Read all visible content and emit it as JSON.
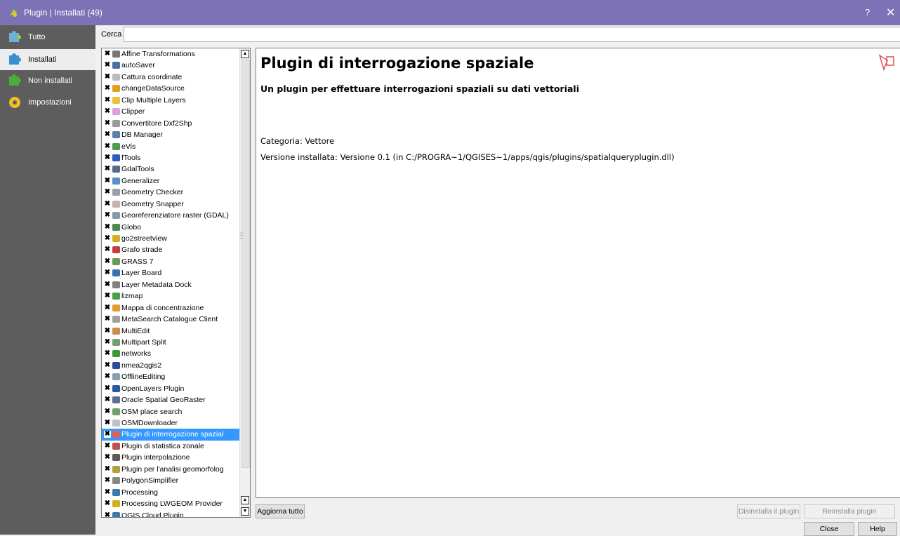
{
  "window": {
    "title": "Plugin | Installati (49)",
    "help_label": "?",
    "close_label": "✕"
  },
  "nav": {
    "items": [
      {
        "label": "Tutto",
        "icon": "puzzle-all-icon",
        "selected": false
      },
      {
        "label": "Installati",
        "icon": "puzzle-installed-icon",
        "selected": true
      },
      {
        "label": "Non installati",
        "icon": "puzzle-not-installed-icon",
        "selected": false
      },
      {
        "label": "Impostazioni",
        "icon": "gear-icon",
        "selected": false
      }
    ]
  },
  "search": {
    "label": "Cerca",
    "value": "",
    "placeholder": ""
  },
  "plugins": [
    {
      "name": "Affine Transformations",
      "color": "#777777"
    },
    {
      "name": "autoSaver",
      "color": "#4a6fa5"
    },
    {
      "name": "Cattura coordinate",
      "color": "#bbbbbb"
    },
    {
      "name": "changeDataSource",
      "color": "#e0a020"
    },
    {
      "name": "Clip Multiple Layers",
      "color": "#e8c43a"
    },
    {
      "name": "Clipper",
      "color": "#d9a0d9"
    },
    {
      "name": "Convertitore Dxf2Shp",
      "color": "#999999"
    },
    {
      "name": "DB Manager",
      "color": "#5a7fa8"
    },
    {
      "name": "eVis",
      "color": "#4f9a4f"
    },
    {
      "name": "fTools",
      "color": "#2a5fc0"
    },
    {
      "name": "GdalTools",
      "color": "#556b8a"
    },
    {
      "name": "Generalizer",
      "color": "#5a8fc0"
    },
    {
      "name": "Geometry Checker",
      "color": "#9aa0a8"
    },
    {
      "name": "Geometry Snapper",
      "color": "#c8b0b0"
    },
    {
      "name": "Georeferenziatore raster (GDAL)",
      "color": "#8899aa"
    },
    {
      "name": "Globo",
      "color": "#4a8a4a"
    },
    {
      "name": "go2streetview",
      "color": "#d4b020"
    },
    {
      "name": "Grafo strade",
      "color": "#c04040"
    },
    {
      "name": "GRASS 7",
      "color": "#6a9a5a"
    },
    {
      "name": "Layer Board",
      "color": "#3a6fb0"
    },
    {
      "name": "Layer Metadata Dock",
      "color": "#808080"
    },
    {
      "name": "lizmap",
      "color": "#48a048"
    },
    {
      "name": "Mappa di concentrazione",
      "color": "#e0a030"
    },
    {
      "name": "MetaSearch Catalogue Client",
      "color": "#a0a0a0"
    },
    {
      "name": "MultiEdit",
      "color": "#c89050"
    },
    {
      "name": "Multipart Split",
      "color": "#70a070"
    },
    {
      "name": "networks",
      "color": "#3a9a3a"
    },
    {
      "name": "nmea2qgis2",
      "color": "#2a4a9a"
    },
    {
      "name": "OfflineEditing",
      "color": "#8aa0b0"
    },
    {
      "name": "OpenLayers Plugin",
      "color": "#2a5aa0"
    },
    {
      "name": "Oracle Spatial GeoRaster",
      "color": "#5a7090"
    },
    {
      "name": "OSM place search",
      "color": "#70a070"
    },
    {
      "name": "OSMDownloader",
      "color": "#c0c0c0"
    },
    {
      "name": "Plugin di interrogazione spazial",
      "color": "#e06060",
      "selected": true
    },
    {
      "name": "Plugin di statistica zonale",
      "color": "#c05050"
    },
    {
      "name": "Plugin interpolazione",
      "color": "#5a5a5a"
    },
    {
      "name": "Plugin per l'analisi geomorfolog",
      "color": "#b0a040"
    },
    {
      "name": "PolygonSimplifier",
      "color": "#888888"
    },
    {
      "name": "Processing",
      "color": "#3a7ab0"
    },
    {
      "name": "Processing LWGEOM Provider",
      "color": "#d4b020"
    },
    {
      "name": "QGIS Cloud Plugin",
      "color": "#3a7ab0"
    }
  ],
  "details": {
    "title": "Plugin di interrogazione spaziale",
    "subtitle": "Un plugin per effettuare interrogazioni spaziali su dati vettoriali",
    "category": "Categoria: Vettore",
    "version": "Versione installata: Versione 0.1 (in C:/PROGRA~1/QGISES~1/apps/qgis/plugins/spatialqueryplugin.dll)"
  },
  "buttons": {
    "update_all": "Aggiorna tutto",
    "uninstall": "Disinstalla il plugin",
    "reinstall": "Reinstalla plugin",
    "close": "Close",
    "help": "Help"
  }
}
